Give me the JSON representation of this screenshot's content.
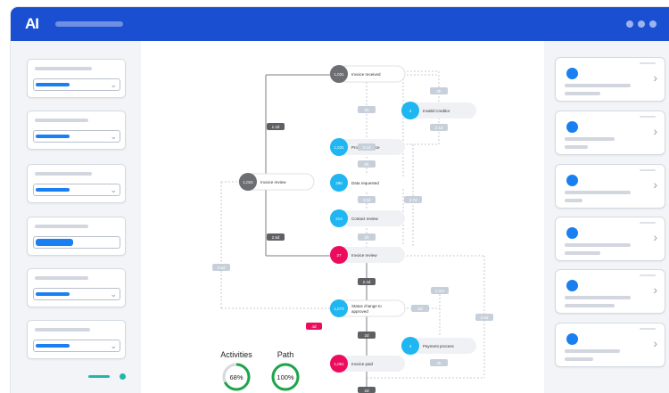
{
  "app": {
    "logo": "AI"
  },
  "flow": {
    "nodes": [
      {
        "id": "invoice_received",
        "count": "1,031",
        "label": "Invoice received",
        "color": "#6d6e71"
      },
      {
        "id": "invalid_creditor",
        "count": "4",
        "label": "Invalid Creditor",
        "color": "#1fb6f2"
      },
      {
        "id": "process_invoice",
        "count": "1,031",
        "label": "Process invoice",
        "color": "#1fb6f2"
      },
      {
        "id": "invoice_review_left",
        "count": "1,022",
        "label": "Invoice review",
        "color": "#6d6e71"
      },
      {
        "id": "data_requested",
        "count": "298",
        "label": "Data requested",
        "color": "#1fb6f2"
      },
      {
        "id": "contact_review",
        "count": "214",
        "label": "Contact review",
        "color": "#1fb6f2"
      },
      {
        "id": "invoice_review",
        "count": "27",
        "label": "Invoice review",
        "color": "#ec0c5e"
      },
      {
        "id": "status_change",
        "count": "1,073",
        "label": "Status change to",
        "label2": "approved",
        "color": "#1fb6f2"
      },
      {
        "id": "payment_process",
        "count": "4",
        "label": "Payment process",
        "color": "#1fb6f2"
      },
      {
        "id": "invoice_paid",
        "count": "1,051",
        "label": "Invoice paid",
        "color": "#ec0c5e"
      }
    ],
    "edge_badges": [
      {
        "id": "b_1_2d",
        "text": "1.2d",
        "dark": true
      },
      {
        "id": "b_2_5d",
        "text": "2.5d",
        "dark": true
      },
      {
        "id": "b_2_4d",
        "text": "2.4d",
        "dark": true
      },
      {
        "id": "b_2d",
        "text": "2d",
        "dark": true
      },
      {
        "id": "b_2d_b",
        "text": "2d",
        "dark": true
      },
      {
        "id": "b_6h_a",
        "text": "6h",
        "dark": false
      },
      {
        "id": "b_3h",
        "text": "3h",
        "dark": false
      },
      {
        "id": "b_2_1d",
        "text": "2.1d",
        "dark": false
      },
      {
        "id": "b_3_5d",
        "text": "3.5d",
        "dark": false
      },
      {
        "id": "b_2_7d",
        "text": "2.7d",
        "dark": false
      },
      {
        "id": "b_2_6d",
        "text": "2.6d",
        "dark": false
      },
      {
        "id": "b_2h",
        "text": "2h",
        "dark": false
      },
      {
        "id": "b_3_6d",
        "text": "3.6d",
        "dark": false
      },
      {
        "id": "b_1_1m",
        "text": "1.1m",
        "dark": false
      },
      {
        "id": "b_5d",
        "text": "5d",
        "dark": false
      },
      {
        "id": "b_3_1d",
        "text": "3.1d",
        "dark": false
      },
      {
        "id": "b_4h",
        "text": "4h",
        "dark": false
      },
      {
        "id": "b_6h_b",
        "text": "6h",
        "dark": false
      },
      {
        "id": "b_4d",
        "text": "4d",
        "pink": true
      }
    ],
    "metrics": [
      {
        "title": "Activities",
        "value": "68%",
        "fraction": 0.68
      },
      {
        "title": "Path",
        "value": "100%",
        "fraction": 1.0
      }
    ]
  },
  "colors": {
    "accent": "#1a4fd1",
    "blue_node": "#1fb6f2",
    "pink_node": "#ec0c5e",
    "gray_node": "#6d6e71",
    "green_ring": "#1ea54a"
  }
}
